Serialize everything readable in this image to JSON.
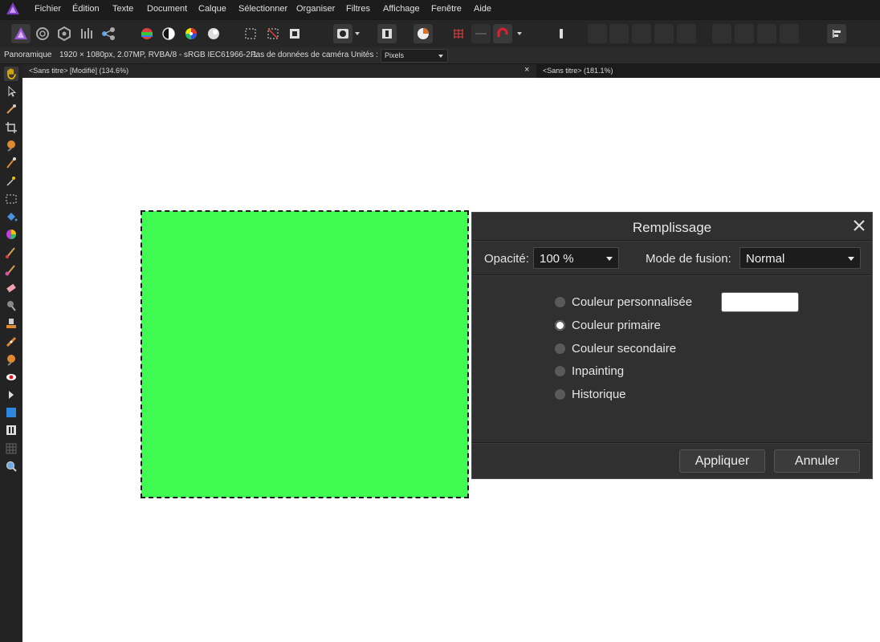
{
  "menu": [
    "Fichier",
    "Édition",
    "Texte",
    "Document",
    "Calque",
    "Sélectionner",
    "Organiser",
    "Filtres",
    "Affichage",
    "Fenêtre",
    "Aide"
  ],
  "context": {
    "tool": "Panoramique",
    "doc_info": "1920 × 1080px, 2.07MP, RVBA/8 - sRGB IEC61966-2.1",
    "camera": "Pas de données de caméra",
    "units_label": "Unités :",
    "units_value": "Pixels"
  },
  "tabs": [
    {
      "label": "<Sans titre> [Modifié] (134.6%)"
    },
    {
      "label": "<Sans titre> (181.1%)"
    }
  ],
  "tab_close_glyph": "×",
  "canvas": {
    "fill_color": "#3ffb52"
  },
  "dialog": {
    "title": "Remplissage",
    "opacity_label": "Opacité:",
    "opacity_value": "100 %",
    "blend_label": "Mode de fusion:",
    "blend_value": "Normal",
    "options": [
      {
        "label": "Couleur personnalisée",
        "checked": false
      },
      {
        "label": "Couleur primaire",
        "checked": true
      },
      {
        "label": "Couleur secondaire",
        "checked": false
      },
      {
        "label": "Inpainting",
        "checked": false
      },
      {
        "label": "Historique",
        "checked": false
      }
    ],
    "custom_color": "#ffffff",
    "apply_label": "Appliquer",
    "cancel_label": "Annuler"
  }
}
